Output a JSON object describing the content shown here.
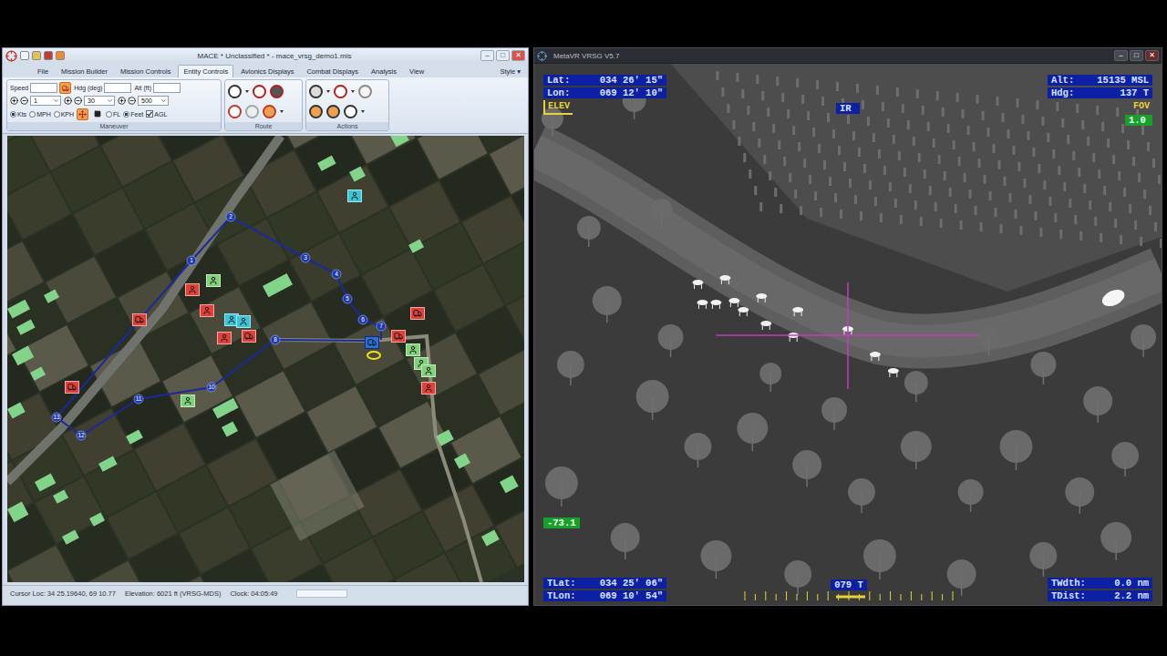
{
  "mace": {
    "window": {
      "title": "MACE * Unclassified * - mace_vrsg_demo1.mis",
      "controls": [
        "–",
        "□",
        "✕"
      ]
    },
    "menu": [
      {
        "label": "File",
        "selected": false
      },
      {
        "label": "Mission Builder",
        "selected": false
      },
      {
        "label": "Mission Controls",
        "selected": false
      },
      {
        "label": "Entity Controls",
        "selected": true
      },
      {
        "label": "Avionics Displays",
        "selected": false
      },
      {
        "label": "Combat Displays",
        "selected": false
      },
      {
        "label": "Analysis",
        "selected": false
      },
      {
        "label": "View",
        "selected": false
      }
    ],
    "style_menu": "Style ▾",
    "maneuver": {
      "label": "Maneuver",
      "fields": [
        {
          "label": "Speed",
          "value": "",
          "step": "1"
        },
        {
          "label": "Hdg (deg)",
          "value": "",
          "step": "30"
        },
        {
          "label": "Alt (ft)",
          "value": "",
          "step": "500"
        }
      ],
      "speed_units": [
        {
          "label": "Kts",
          "selected": true
        },
        {
          "label": "MPH",
          "selected": false
        },
        {
          "label": "KPH",
          "selected": false
        }
      ],
      "alt_modes": [
        {
          "label": "FL",
          "selected": false
        },
        {
          "label": "Feet",
          "selected": true
        }
      ],
      "agl": {
        "label": "AGL",
        "checked": true
      }
    },
    "route_group": {
      "label": "Route"
    },
    "actions_group": {
      "label": "Actions"
    },
    "map": {
      "waypoints": [
        "2",
        "1",
        "3",
        "4",
        "5",
        "6",
        "7",
        "8",
        "10",
        "11",
        "12",
        "13"
      ],
      "entities": [
        {
          "kind": "person",
          "color": "#38c6d6",
          "selected": false
        },
        {
          "kind": "person",
          "color": "#7fd27a",
          "selected": false
        },
        {
          "kind": "person",
          "color": "#e2413a",
          "selected": false
        },
        {
          "kind": "person",
          "color": "#e2413a",
          "selected": false
        },
        {
          "kind": "person",
          "color": "#38c6d6",
          "selected": false
        },
        {
          "kind": "person",
          "color": "#38c6d6",
          "selected": false
        },
        {
          "kind": "person",
          "color": "#e2413a",
          "selected": false
        },
        {
          "kind": "vehicle",
          "color": "#e2413a",
          "selected": false
        },
        {
          "kind": "vehicle",
          "color": "#e2413a",
          "selected": false
        },
        {
          "kind": "vehicle",
          "color": "#e2413a",
          "selected": false
        },
        {
          "kind": "person",
          "color": "#7fd27a",
          "selected": false
        },
        {
          "kind": "vehicle",
          "color": "#e2413a",
          "selected": false
        },
        {
          "kind": "vehicle",
          "color": "#e2413a",
          "selected": false
        },
        {
          "kind": "person",
          "color": "#7fd27a",
          "selected": false
        },
        {
          "kind": "person",
          "color": "#7fd27a",
          "selected": false
        },
        {
          "kind": "person",
          "color": "#7fd27a",
          "selected": false
        },
        {
          "kind": "person",
          "color": "#e2413a",
          "selected": false
        },
        {
          "kind": "vehicle",
          "color": "#2b6fd8",
          "selected": true
        }
      ]
    },
    "status_bar": {
      "cursor": "Cursor Loc: 34 25.19640, 69 10.77",
      "elevation": "Elevation: 6021 ft (VRSG-MDS)",
      "clock": "Clock: 04:05:49"
    }
  },
  "vrsg": {
    "window": {
      "title": "MetaVR VRSG V5.7",
      "controls": [
        "–",
        "□",
        "✕"
      ]
    },
    "hud": {
      "lat": {
        "label": "Lat:",
        "value": "034 26' 15\""
      },
      "lon": {
        "label": "Lon:",
        "value": "069 12' 10\""
      },
      "alt": {
        "label": "Alt:",
        "value": "15135 MSL"
      },
      "hdg": {
        "label": "Hdg:",
        "value": "137 T"
      },
      "elev": "ELEV",
      "sensor": "IR",
      "fov_label": "FOV",
      "fov": "1.0",
      "elevation_angle": "-73.1",
      "tlat": {
        "label": "TLat:",
        "value": "034 25' 06\""
      },
      "tlon": {
        "label": "TLon:",
        "value": "069 10' 54\""
      },
      "azimuth": "079 T",
      "twdth": {
        "label": "TWdth:",
        "value": "0.0 nm"
      },
      "tdist": {
        "label": "TDist:",
        "value": "2.2 nm"
      }
    }
  }
}
